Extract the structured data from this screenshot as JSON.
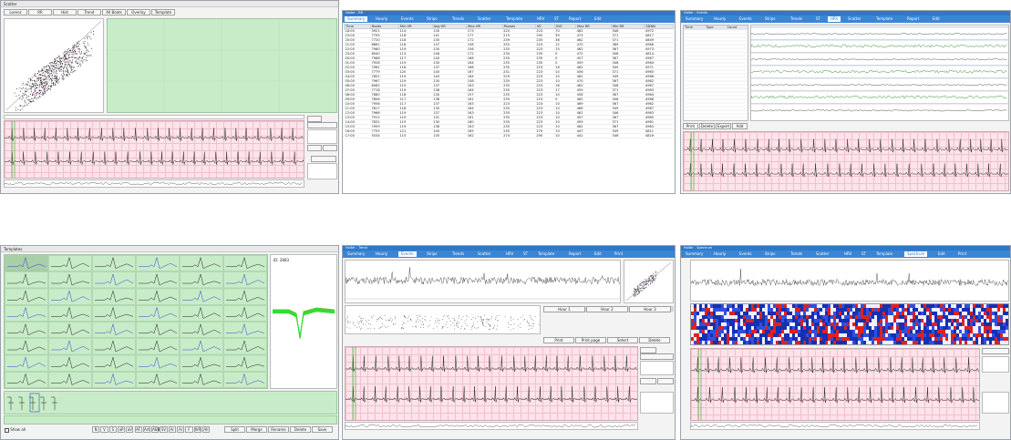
{
  "panels": {
    "scatter_window": {
      "title": "Scatter",
      "toolbar": [
        "Lorenz",
        "RR",
        "Hist",
        "Trend",
        "All Beats",
        "Overlay",
        "Template"
      ]
    },
    "table_window": {
      "title": "Holter - RR",
      "tabs": [
        "Summary",
        "Hourly",
        "Events",
        "Strips",
        "Trends",
        "Scatter",
        "Template",
        "HRV",
        "ST",
        "Report",
        "Edit"
      ],
      "columns": [
        "Time",
        "Beats",
        "Min HR",
        "Avg HR",
        "Max HR",
        "Pauses",
        "VE",
        "SVE",
        "Max RR",
        "Min RR",
        "SDNN"
      ],
      "rows": [
        [
          "18:00",
          "3921",
          "114",
          "130",
          "173",
          "220",
          "223",
          "70",
          "462",
          "346",
          "4972"
        ],
        [
          "19:00",
          "7795",
          "116",
          "141",
          "177",
          "219",
          "290",
          "39",
          "473",
          "371",
          "4817"
        ],
        [
          "20:00",
          "7720",
          "118",
          "135",
          "172",
          "239",
          "235",
          "36",
          "462",
          "371",
          "4849"
        ],
        [
          "21:00",
          "8661",
          "116",
          "137",
          "158",
          "255",
          "223",
          "12",
          "470",
          "389",
          "4966"
        ],
        [
          "22:00",
          "7960",
          "119",
          "130",
          "156",
          "235",
          "223",
          "15",
          "462",
          "367",
          "4973"
        ],
        [
          "23:00",
          "8040",
          "113",
          "146",
          "172",
          "235",
          "235",
          "0",
          "472",
          "346",
          "4814"
        ],
        [
          "00:00",
          "7968",
          "117",
          "140",
          "166",
          "235",
          "235",
          "0",
          "457",
          "367",
          "4967"
        ],
        [
          "01:00",
          "7928",
          "119",
          "130",
          "164",
          "235",
          "235",
          "0",
          "459",
          "346",
          "4964"
        ],
        [
          "02:00",
          "7961",
          "118",
          "137",
          "166",
          "235",
          "223",
          "16",
          "462",
          "349",
          "4971"
        ],
        [
          "03:00",
          "7779",
          "120",
          "140",
          "167",
          "231",
          "223",
          "10",
          "456",
          "371",
          "4965"
        ],
        [
          "04:00",
          "7851",
          "119",
          "140",
          "164",
          "229",
          "223",
          "10",
          "462",
          "349",
          "4966"
        ],
        [
          "05:00",
          "7967",
          "119",
          "130",
          "158",
          "235",
          "223",
          "10",
          "470",
          "367",
          "4962"
        ],
        [
          "06:00",
          "8062",
          "115",
          "137",
          "163",
          "235",
          "223",
          "16",
          "462",
          "346",
          "4967"
        ],
        [
          "07:00",
          "7718",
          "119",
          "138",
          "164",
          "235",
          "223",
          "17",
          "459",
          "371",
          "4963"
        ],
        [
          "08:00",
          "7680",
          "118",
          "130",
          "157",
          "235",
          "223",
          "10",
          "458",
          "367",
          "4964"
        ],
        [
          "09:00",
          "7856",
          "117",
          "138",
          "161",
          "235",
          "223",
          "0",
          "462",
          "346",
          "4968"
        ],
        [
          "10:00",
          "7956",
          "117",
          "137",
          "163",
          "223",
          "223",
          "10",
          "469",
          "367",
          "4962"
        ],
        [
          "11:00",
          "7817",
          "118",
          "130",
          "164",
          "235",
          "223",
          "10",
          "466",
          "349",
          "4967"
        ],
        [
          "12:00",
          "7966",
          "119",
          "137",
          "163",
          "235",
          "223",
          "10",
          "462",
          "346",
          "4963"
        ],
        [
          "13:00",
          "7912",
          "119",
          "131",
          "161",
          "235",
          "223",
          "10",
          "457",
          "367",
          "4965"
        ],
        [
          "14:00",
          "7831",
          "119",
          "130",
          "160",
          "235",
          "223",
          "10",
          "459",
          "371",
          "4961"
        ],
        [
          "15:00",
          "7959",
          "119",
          "138",
          "163",
          "235",
          "223",
          "10",
          "462",
          "367",
          "4963"
        ],
        [
          "16:00",
          "7755",
          "121",
          "140",
          "165",
          "230",
          "270",
          "10",
          "447",
          "349",
          "4811"
        ],
        [
          "17:00",
          "5534",
          "115",
          "135",
          "162",
          "274",
          "290",
          "10",
          "441",
          "346",
          "4816"
        ]
      ]
    },
    "event_window": {
      "title": "Holter - Events",
      "tabs": [
        "Summary",
        "Hourly",
        "Events",
        "Strips",
        "Trends",
        "ST",
        "HRV",
        "Scatter",
        "Template",
        "Report",
        "Edit"
      ],
      "list_header": [
        "Time",
        "Type",
        "Count"
      ],
      "buttons": [
        "Print",
        "Delete",
        "Export",
        "Add"
      ]
    },
    "template_window": {
      "title": "Templates",
      "side_label": "ID: 2883",
      "bottom_buttons": [
        "N",
        "V",
        "S",
        "aP",
        "aV",
        "AF",
        "Art",
        "ABB",
        "SV",
        "Ar",
        "Ar",
        "F",
        "IVR",
        "All"
      ],
      "right_buttons": [
        "Split",
        "Merge",
        "Rename",
        "Delete",
        "Save"
      ],
      "checkbox_label": "Show all"
    },
    "trend_window": {
      "title": "Holter - Trend",
      "tabs": [
        "Summary",
        "Hourly",
        "Events",
        "Strips",
        "Trends",
        "Scatter",
        "HRV",
        "ST",
        "Template",
        "Report",
        "Edit",
        "Print"
      ],
      "mid_labels": [
        "Hour 1",
        "Hour 2",
        "Hour 3"
      ],
      "button_row": [
        "Print",
        "Print page",
        "Select",
        "Delete"
      ]
    },
    "spectrum_window": {
      "title": "Holter - Spectrum",
      "tabs": [
        "Summary",
        "Hourly",
        "Events",
        "Strips",
        "Trends",
        "Scatter",
        "HRV",
        "ST",
        "Template",
        "Spectrum",
        "Edit",
        "Print"
      ]
    }
  }
}
